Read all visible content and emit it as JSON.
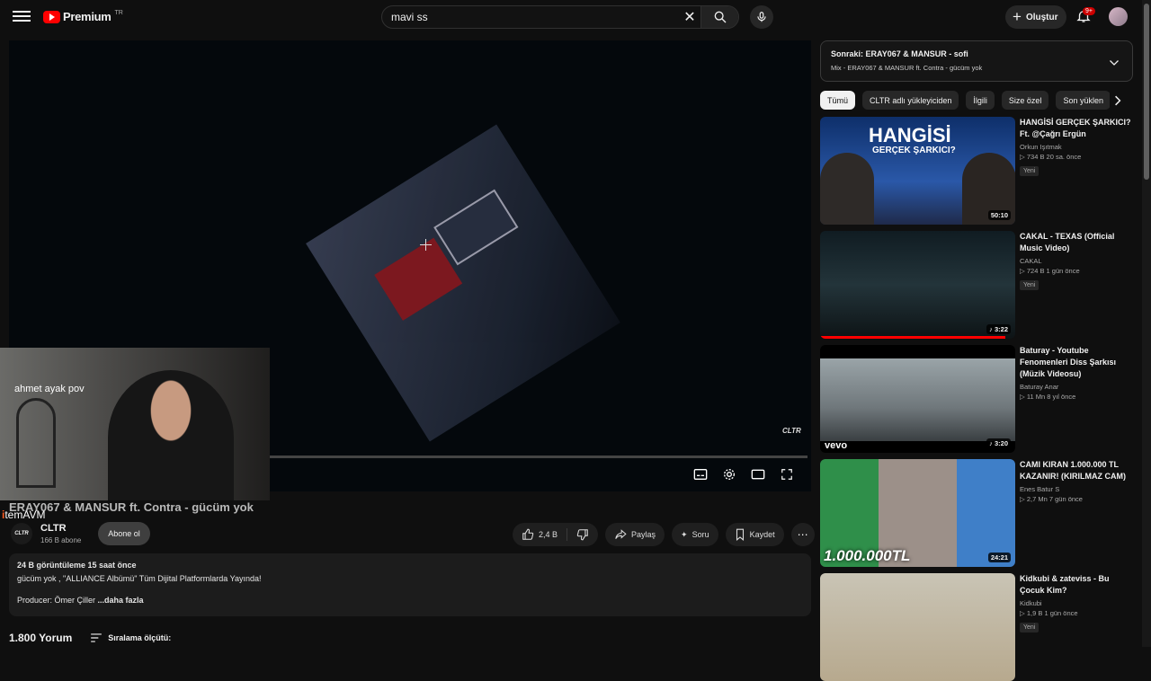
{
  "header": {
    "logo_text": "Premium",
    "region": "TR",
    "search_value": "mavi ss",
    "create_label": "Oluştur",
    "notif_count": "9+"
  },
  "player": {
    "watermark": "CLTR",
    "webcam_text": "ahmet ayak pov",
    "sponsor_text": "temAVM",
    "sponsor_letter": "i"
  },
  "video": {
    "title": "ERAY067 & MANSUR ft. Contra - gücüm yok",
    "channel": "CLTR",
    "channel_logo": "CLTR",
    "subs": "166 B abone",
    "subscribe": "Abone ol",
    "likes": "2,4 B",
    "share": "Paylaş",
    "ask": "Soru",
    "save": "Kaydet"
  },
  "description": {
    "meta": "24 B görüntüleme  15 saat önce",
    "line1": "gücüm yok , \"ALLIANCE Albümü\" Tüm Dijital Platformlarda Yayında!",
    "line2": "Producer: Ömer Çiller",
    "more": "...daha fazla"
  },
  "comments": {
    "count": "1.800 Yorum",
    "sort": "Sıralama ölçütü:"
  },
  "up_next": {
    "label": "Sonraki:",
    "title": "ERAY067 & MANSUR - sofi",
    "subtitle": "Mix - ERAY067 & MANSUR ft. Contra - gücüm yok"
  },
  "chips": [
    "Tümü",
    "CLTR adlı yükleyiciden",
    "İlgili",
    "Size özel",
    "Son yüklen"
  ],
  "recommendations": [
    {
      "title": "HANGİSİ GERÇEK ŞARKICI? Ft. @Çağrı Ergün",
      "channel": "Orkun Işıtmak",
      "stats": "▷ 734 B  20 sa. önce",
      "badge": "Yeni",
      "duration": "50:10",
      "thumb_text": "HANGİSİ",
      "thumb_sub": "GERÇEK ŞARKICI?",
      "progress": 0
    },
    {
      "title": "CAKAL - TEXAS (Official Music Video)",
      "channel": "CAKAL",
      "stats": "▷ 724 B  1 gün önce",
      "badge": "Yeni",
      "duration": "♪ 3:22",
      "thumb_text": "",
      "thumb_sub": "",
      "progress": 95
    },
    {
      "title": "Baturay - Youtube Fenomenleri Diss Şarkısı (Müzik Videosu)",
      "channel": "Baturay Anar",
      "stats": "▷ 11 Mn  8 yıl önce",
      "badge": "",
      "duration": "♪ 3:20",
      "thumb_text": "vevo",
      "thumb_sub": "",
      "progress": 0
    },
    {
      "title": "CAMI KIRAN 1.000.000 TL KAZANIR! (KIRILMAZ CAM)",
      "channel": "Enes Batur S",
      "stats": "▷ 2,7 Mn  7 gün önce",
      "badge": "",
      "duration": "24:21",
      "thumb_text": "1.000.000TL",
      "thumb_sub": "",
      "progress": 0
    },
    {
      "title": "Kidkubi & zateviss - Bu Çocuk Kim?",
      "channel": "Kidkubi",
      "stats": "▷ 1,9 B  1 gün önce",
      "badge": "Yeni",
      "duration": "",
      "thumb_text": "",
      "thumb_sub": "",
      "progress": 0
    }
  ]
}
